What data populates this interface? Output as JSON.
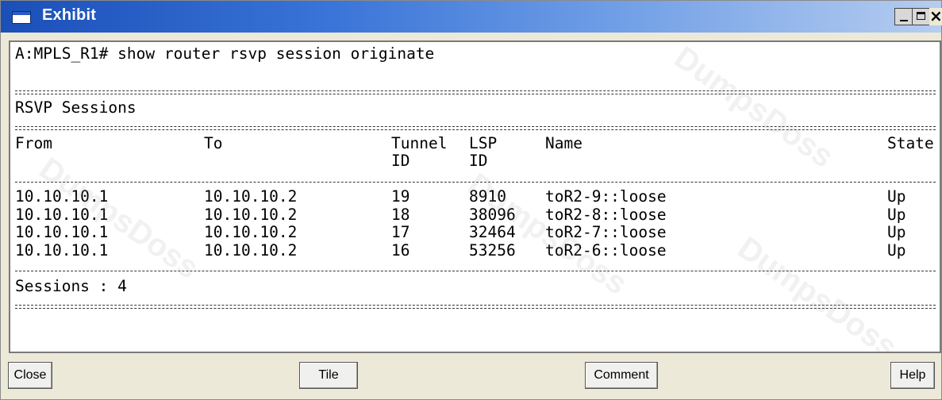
{
  "window": {
    "title": "Exhibit",
    "controls": {
      "minimize": "_",
      "maximize": "□",
      "close": "×"
    }
  },
  "terminal": {
    "command_line": "A:MPLS_R1# show router rsvp session originate",
    "section_title": "RSVP Sessions",
    "headers": {
      "from": "From",
      "to": "To",
      "tunnel_line1": "Tunnel",
      "tunnel_line2": "ID",
      "lsp_line1": "LSP",
      "lsp_line2": "ID",
      "name": "Name",
      "state": "State"
    },
    "rows": [
      {
        "from": "10.10.10.1",
        "to": "10.10.10.2",
        "tunnel_id": "19",
        "lsp_id": "8910",
        "name": "toR2-9::loose",
        "state": "Up"
      },
      {
        "from": "10.10.10.1",
        "to": "10.10.10.2",
        "tunnel_id": "18",
        "lsp_id": "38096",
        "name": "toR2-8::loose",
        "state": "Up"
      },
      {
        "from": "10.10.10.1",
        "to": "10.10.10.2",
        "tunnel_id": "17",
        "lsp_id": "32464",
        "name": "toR2-7::loose",
        "state": "Up"
      },
      {
        "from": "10.10.10.1",
        "to": "10.10.10.2",
        "tunnel_id": "16",
        "lsp_id": "53256",
        "name": "toR2-6::loose",
        "state": "Up"
      }
    ],
    "summary": "Sessions : 4"
  },
  "buttons": {
    "close": "Close",
    "tile": "Tile",
    "comment": "Comment",
    "help": "Help"
  },
  "watermark_text": "DumpsDoss",
  "colors": {
    "titlebar_start": "#1a4fb8",
    "titlebar_end": "#b6cdf0",
    "window_bg": "#ece9d8",
    "terminal_bg": "#ffffff"
  },
  "icons": {
    "title_icon": "window-icon",
    "minimize": "minimize-icon",
    "maximize": "maximize-icon",
    "close": "close-icon"
  }
}
